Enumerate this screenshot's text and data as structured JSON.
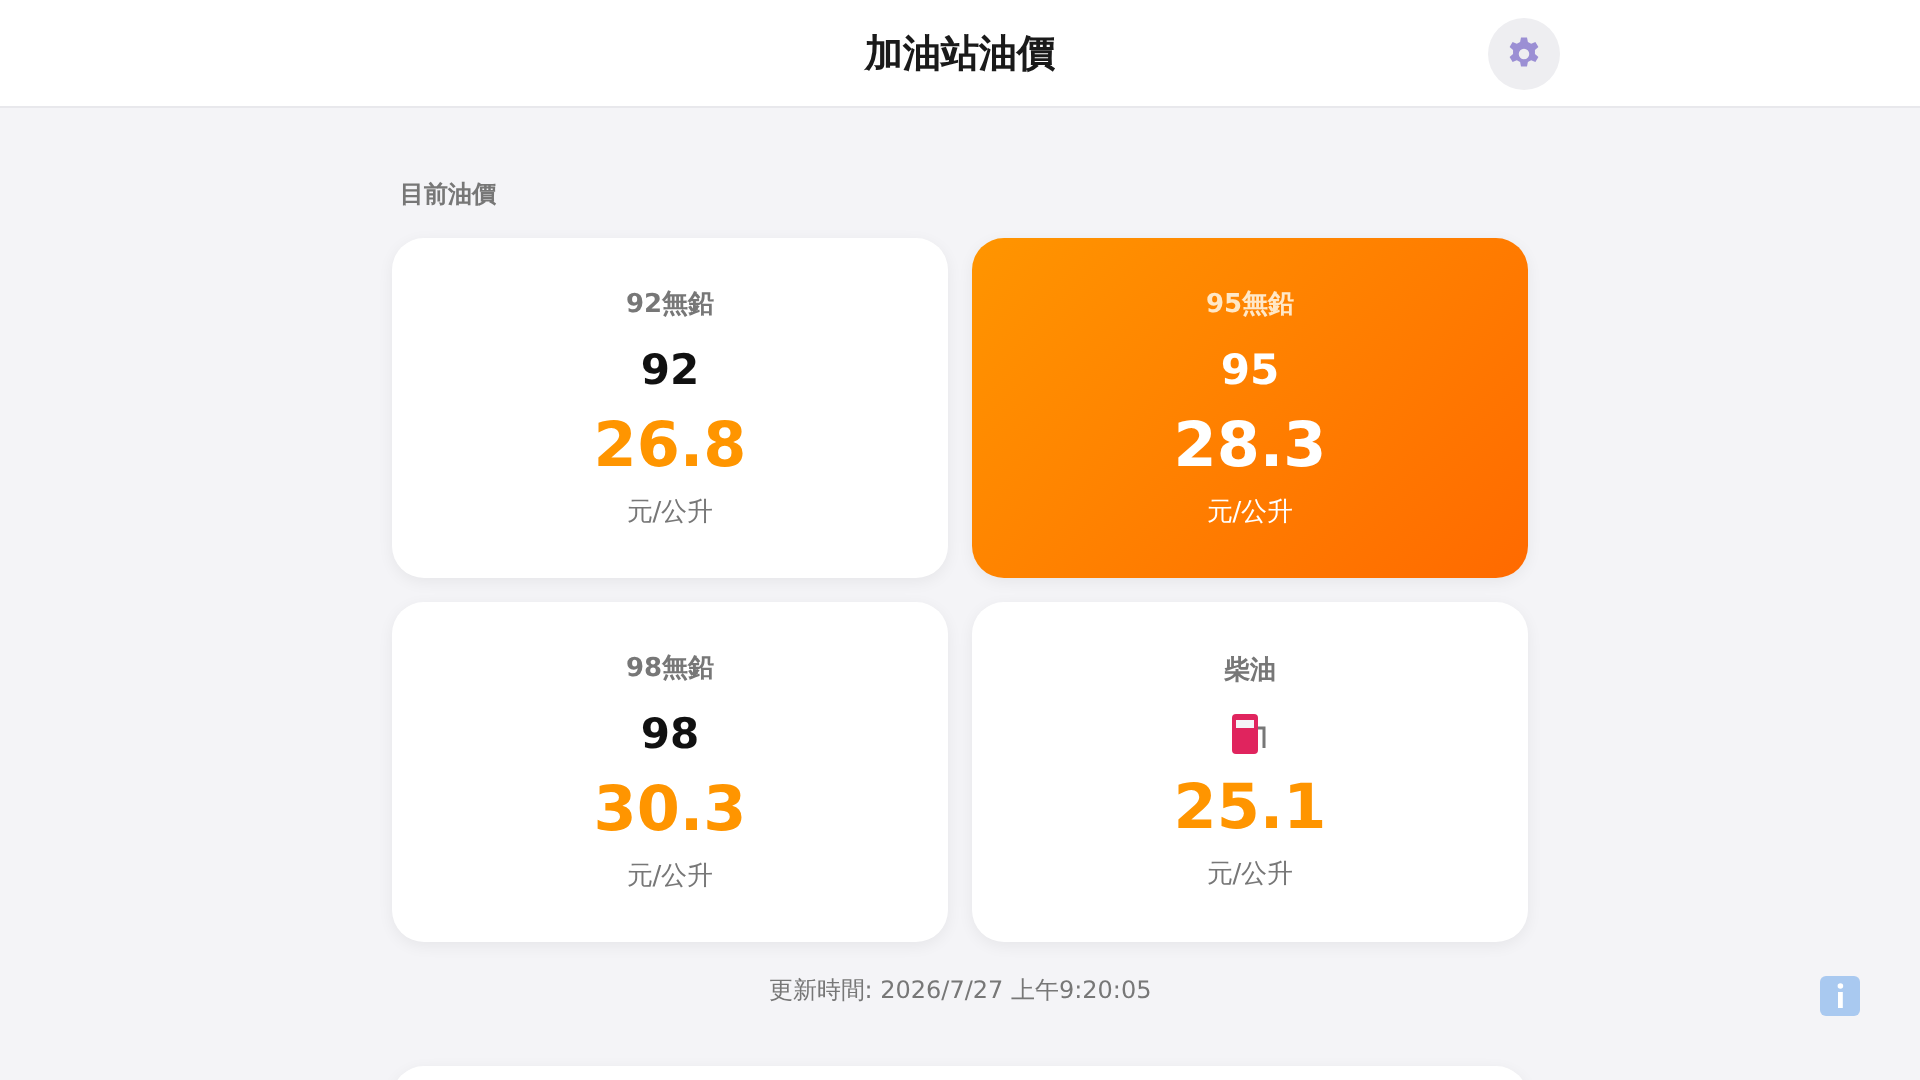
{
  "header": {
    "title": "加油站油價"
  },
  "section": {
    "title": "目前油價"
  },
  "prices": [
    {
      "label": "92無鉛",
      "kind": "code",
      "code": "92",
      "price": "26.8",
      "unit": "元/公升",
      "selected": false
    },
    {
      "label": "95無鉛",
      "kind": "code",
      "code": "95",
      "price": "28.3",
      "unit": "元/公升",
      "selected": true
    },
    {
      "label": "98無鉛",
      "kind": "code",
      "code": "98",
      "price": "30.3",
      "unit": "元/公升",
      "selected": false
    },
    {
      "label": "柴油",
      "kind": "pump",
      "price": "25.1",
      "unit": "元/公升",
      "selected": false
    }
  ],
  "updated": "更新時間: 2026/7/27 上午9:20:05"
}
